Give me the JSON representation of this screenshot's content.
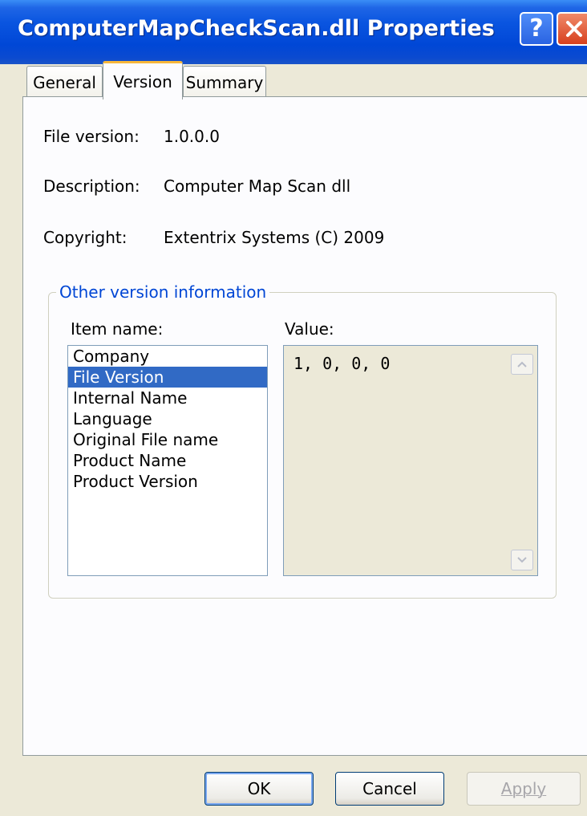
{
  "window": {
    "title": "ComputerMapCheckScan.dll Properties",
    "help_glyph": "?",
    "close_icon": "close-icon"
  },
  "tabs": [
    {
      "label": "General",
      "active": false
    },
    {
      "label": "Version",
      "active": true
    },
    {
      "label": "Summary",
      "active": false
    }
  ],
  "fields": {
    "file_version_label": "File version:",
    "file_version_value": "1.0.0.0",
    "description_label": "Description:",
    "description_value": "Computer Map Scan dll",
    "copyright_label": "Copyright:",
    "copyright_value": "Extentrix Systems (C) 2009"
  },
  "other_info": {
    "group_title": "Other version information",
    "item_name_header": "Item name:",
    "value_header": "Value:",
    "items": [
      "Company",
      "File Version",
      "Internal Name",
      "Language",
      "Original File name",
      "Product Name",
      "Product Version"
    ],
    "selected_index": 1,
    "value": "1, 0, 0, 0"
  },
  "buttons": {
    "ok": "OK",
    "cancel": "Cancel",
    "apply": "Apply",
    "apply_enabled": false
  },
  "colors": {
    "titlebar": "#0047d6",
    "selection": "#316ac5",
    "group_title": "#0046d5",
    "active_tab_accent": "#f7b73b"
  }
}
